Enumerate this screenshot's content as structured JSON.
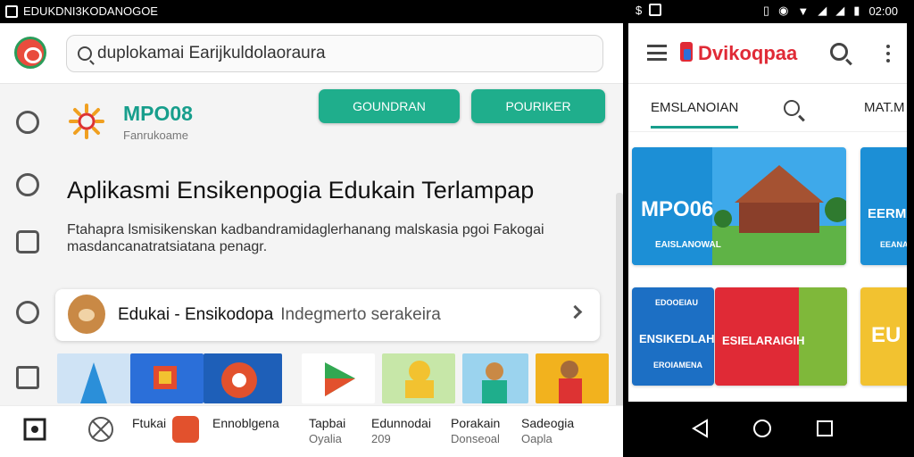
{
  "status_bar": {
    "left_title": "EDUKDNI3KODANOGOE",
    "time": "02:00"
  },
  "left": {
    "search": {
      "value": "duplokamai Earijkuldolaoraura"
    },
    "brand": {
      "name": "MPO08",
      "sub": "Fanrukoame"
    },
    "buttons": [
      "GOUNDRAN",
      "POURIKER"
    ],
    "heading": "Aplikasmi Ensikenpogia Edukain Terlampap",
    "description": "Ftahapra lsmisikenskan kadbandramidaglerhanang malskasia pgoi Fakogai masdancanatratsiatana penagr.",
    "card": {
      "title": "Edukai - Ensikodopa",
      "subtitle": "Indegmerto serakeira"
    },
    "bottom": [
      {
        "label": "Ftukai",
        "sub": ""
      },
      {
        "label": "Ennoblgena",
        "sub": ""
      },
      {
        "label": "Tapbai",
        "sub": "Oyalia"
      },
      {
        "label": "Edunnodai",
        "sub": "209"
      },
      {
        "label": "Porakain",
        "sub": "Donseoal"
      },
      {
        "label": "Sadeogia",
        "sub": "Oapla"
      }
    ]
  },
  "right": {
    "app_title": "Dvikoqpaa",
    "tabs": [
      "EMSLANOIAN",
      "MAT.M"
    ],
    "tiles": {
      "t1": "MPO06",
      "t1_sub": "EAISLANOWAL",
      "t2": "EERMAI",
      "t2_sub": "EEANAR",
      "t3": "EDOOEIAU",
      "t3_main": "ENSIKEDLAH",
      "t3_sub": "EROIAMENA",
      "t4": "ESIELARAIGIH",
      "t5": "EU"
    }
  },
  "colors": {
    "accent": "#1fae8c",
    "brand_red": "#e02a36",
    "blue": "#2b6fd9"
  }
}
